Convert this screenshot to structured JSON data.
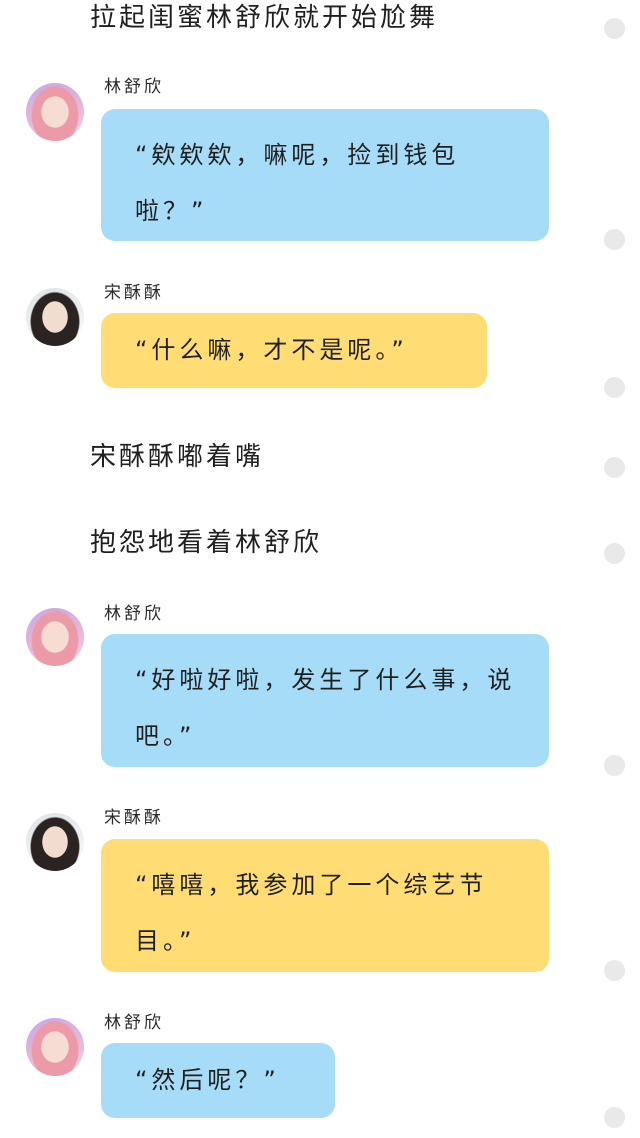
{
  "narration": [
    "拉起闺蜜林舒欣就开始尬舞",
    "宋酥酥嘟着嘴",
    "抱怨地看着林舒欣"
  ],
  "messages": [
    {
      "speaker": "林舒欣",
      "avatar_icon": "pink-hair-girl-avatar",
      "color": "#a6dcf7",
      "text": "“欸欸欸，嘛呢，捡到钱包啦？”"
    },
    {
      "speaker": "宋酥酥",
      "avatar_icon": "dark-hair-girl-avatar",
      "color": "#ffdd74",
      "text": "“什么嘛，才不是呢。”"
    },
    {
      "speaker": "林舒欣",
      "avatar_icon": "pink-hair-girl-avatar",
      "color": "#a6dcf7",
      "text": "“好啦好啦，发生了什么事，说吧。”"
    },
    {
      "speaker": "宋酥酥",
      "avatar_icon": "dark-hair-girl-avatar",
      "color": "#ffdd74",
      "text": "“嘻嘻，我参加了一个综艺节目。”"
    },
    {
      "speaker": "林舒欣",
      "avatar_icon": "pink-hair-girl-avatar",
      "color": "#a6dcf7",
      "text": "“然后呢？”"
    }
  ]
}
